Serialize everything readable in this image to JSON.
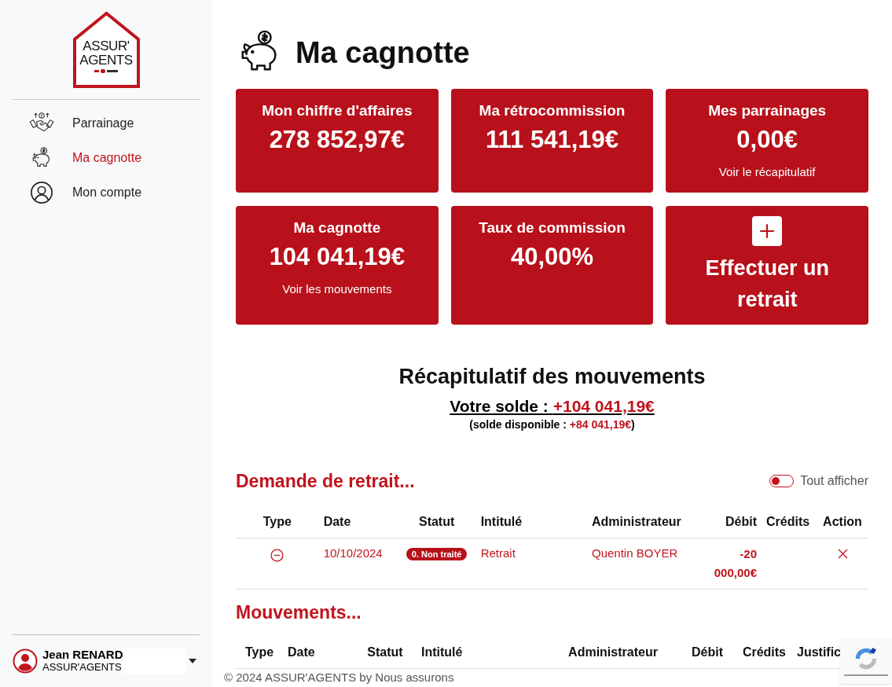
{
  "sidebar": {
    "logo": {
      "line_1": "ASSUR'",
      "line_2": "AGENTS"
    },
    "items": [
      {
        "label": "Parrainage",
        "selected": false
      },
      {
        "label": "Ma cagnotte",
        "selected": true
      },
      {
        "label": "Mon compte",
        "selected": false
      }
    ],
    "user": {
      "name": "Jean RENARD",
      "company": "ASSUR'AGENTS"
    }
  },
  "page": {
    "title": "Ma cagnotte"
  },
  "cards": [
    {
      "kind": "stat",
      "title": "Mon chiffre d'affaires",
      "value": "278 852,97€"
    },
    {
      "kind": "stat",
      "title": "Ma rétrocommission",
      "value": "111 541,19€"
    },
    {
      "kind": "stat",
      "title": "Mes parrainages",
      "value": "0,00€",
      "link": "Voir le récapitulatif"
    },
    {
      "kind": "stat",
      "title": "Ma cagnotte",
      "value": "104 041,19€",
      "link": "Voir les mouvements"
    },
    {
      "kind": "stat",
      "title": "Taux de commission",
      "value": "40,00%"
    },
    {
      "kind": "action",
      "title": "Effectuer un retrait"
    }
  ],
  "summary": {
    "title": "Récapitulatif des mouvements",
    "balance_label": "Votre solde : ",
    "balance": "+104 041,19€",
    "available_label": "(solde disponible : ",
    "available": "+84 041,19€",
    "available_end": ")"
  },
  "withdrawals": {
    "title": "Demande de retrait...",
    "toggle": {
      "label": "Tout afficher",
      "on": false
    },
    "columns": [
      "Type",
      "Date",
      "Statut",
      "Intitulé",
      "Administrateur",
      "Débit",
      "Crédits",
      "Action"
    ],
    "rows": [
      {
        "date": "10/10/2024",
        "status": "0. Non traité",
        "label": "Retrait",
        "admin": "Quentin BOYER",
        "debit": "-20 000,00€",
        "credit": ""
      }
    ]
  },
  "movements": {
    "title": "Mouvements...",
    "columns": [
      "Type",
      "Date",
      "Statut",
      "Intitulé",
      "Administrateur",
      "Débit",
      "Crédits",
      "Justific"
    ]
  },
  "footer": "© 2024 ASSUR'AGENTS by Nous assurons"
}
